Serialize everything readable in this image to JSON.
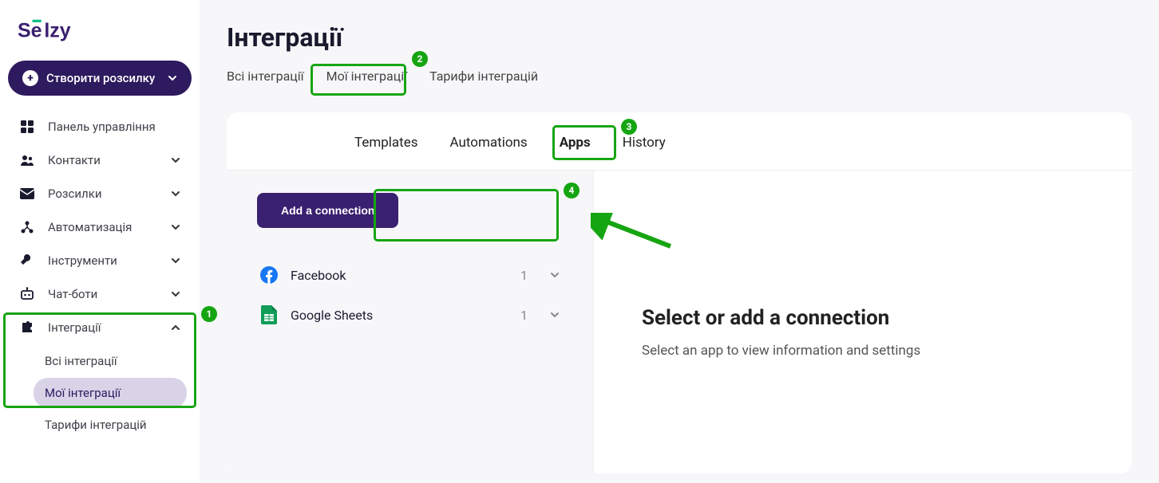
{
  "logo_text": "Sēlzy",
  "create_button": "Створити розсилку",
  "nav": {
    "dashboard": "Панель управління",
    "contacts": "Контакти",
    "campaigns": "Розсилки",
    "automation": "Автоматизація",
    "tools": "Інструменти",
    "chatbots": "Чат-боти",
    "integrations": "Інтеграції"
  },
  "nav_sub_integrations": {
    "all": "Всі інтеграції",
    "mine": "Мої інтеграції",
    "pricing": "Тарифи інтеграцій"
  },
  "page_title": "Інтеграції",
  "top_tabs": {
    "all": "Всі інтеграції",
    "mine": "Мої інтеграції",
    "pricing": "Тарифи інтеграцій"
  },
  "card_tabs": {
    "templates": "Templates",
    "automations": "Automations",
    "apps": "Apps",
    "history": "History"
  },
  "add_connection": "Add a connection",
  "connections": [
    {
      "name": "Facebook",
      "count": "1",
      "icon": "facebook"
    },
    {
      "name": "Google Sheets",
      "count": "1",
      "icon": "gsheets"
    }
  ],
  "right_panel": {
    "title": "Select or add a connection",
    "subtitle": "Select an app to view information and settings"
  },
  "annotations": {
    "b1": "1",
    "b2": "2",
    "b3": "3",
    "b4": "4"
  }
}
